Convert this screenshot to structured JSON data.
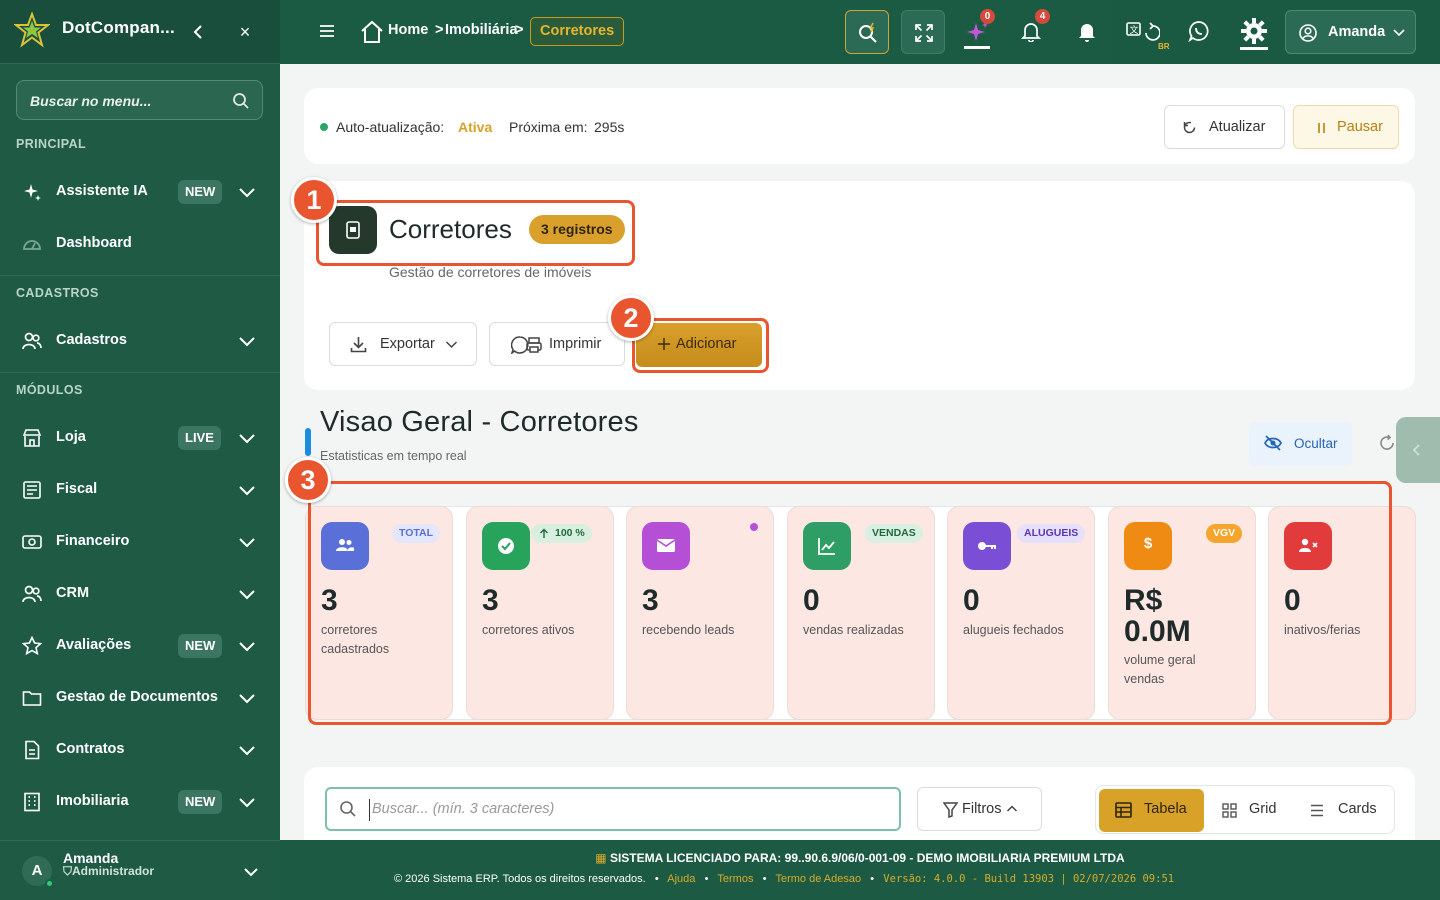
{
  "sidebar": {
    "brand": "DotCompan...",
    "search_placeholder": "Buscar no menu...",
    "sections": {
      "principal": "PRINCIPAL",
      "cadastros": "CADASTROS",
      "modulos": "MÓDULOS"
    },
    "items": [
      {
        "label": "Assistente IA",
        "badge": "NEW",
        "icon": "sparkle-icon"
      },
      {
        "label": "Dashboard",
        "icon": "gauge-icon"
      },
      {
        "label": "Cadastros",
        "icon": "users-icon"
      },
      {
        "label": "Loja",
        "badge": "LIVE",
        "icon": "store-icon"
      },
      {
        "label": "Fiscal",
        "icon": "receipt-icon"
      },
      {
        "label": "Financeiro",
        "icon": "cash-icon"
      },
      {
        "label": "CRM",
        "icon": "users-icon"
      },
      {
        "label": "Avaliações",
        "badge": "NEW",
        "icon": "star-icon"
      },
      {
        "label": "Gestao de Documentos",
        "icon": "folder-icon"
      },
      {
        "label": "Contratos",
        "icon": "document-icon"
      },
      {
        "label": "Imobiliaria",
        "badge": "NEW",
        "icon": "building-icon"
      }
    ],
    "user": {
      "initial": "A",
      "name": "Amanda",
      "role": "Administrador"
    }
  },
  "topbar": {
    "breadcrumb": {
      "home": "Home",
      "sep1": ">",
      "section": "Imobiliária",
      "sep2": ">",
      "current": "Corretores"
    },
    "sparkle_count": "0",
    "notification_count": "4",
    "lang_tag": "BR",
    "user_name": "Amanda"
  },
  "autorefresh": {
    "label": "Auto-atualização:",
    "status": "Ativa",
    "next_label": "Próxima em:",
    "next_value": "295s",
    "update_button": "Atualizar",
    "pause_button": "Pausar"
  },
  "header": {
    "title": "Corretores",
    "count_badge": "3 registros",
    "subtitle": "Gestão de corretores de imóveis",
    "export_button": "Exportar",
    "print_button": "Imprimir",
    "add_button": "Adicionar"
  },
  "overview": {
    "title": "Visao Geral - Corretores",
    "subtitle": "Estatisticas em tempo real",
    "hide_button": "Ocultar"
  },
  "stats": [
    {
      "value": "3",
      "label": "corretores cadastrados",
      "badge": "TOTAL",
      "color": "#5b6fd8"
    },
    {
      "value": "3",
      "label": "corretores ativos",
      "badge": "100 %",
      "color": "#27a35c"
    },
    {
      "value": "3",
      "label": "recebendo leads",
      "badge": "",
      "color": "#b54fd6"
    },
    {
      "value": "0",
      "label": "vendas realizadas",
      "badge": "VENDAS",
      "color": "#2e9e66"
    },
    {
      "value": "0",
      "label": "alugueis fechados",
      "badge": "ALUGUEIS",
      "color": "#7a4fd6"
    },
    {
      "value": "R$ 0.0M",
      "label": "volume geral vendas",
      "badge": "VGV",
      "color": "#ef8a12"
    },
    {
      "value": "0",
      "label": "inativos/ferias",
      "badge": "",
      "color": "#e23b3b"
    }
  ],
  "list": {
    "search_placeholder": "Buscar... (mín. 3 caracteres)",
    "filters_button": "Filtros",
    "views": [
      "Tabela",
      "Grid",
      "Cards"
    ],
    "active_view": "Tabela"
  },
  "footer": {
    "license_label": "SISTEMA LICENCIADO PARA:",
    "license_value": "99..90.6.9/06/0-001-09 - DEMO IMOBILIARIA PREMIUM LTDA",
    "copyright": "© 2026 Sistema ERP. Todos os direitos reservados.",
    "links": [
      "Ajuda",
      "Termos",
      "Termo de Adesao"
    ],
    "version": "Versão: 4.0.0 - Build 13903 | 02/07/2026 09:51"
  },
  "annotations": [
    "1",
    "2",
    "3"
  ],
  "colors": {
    "sidebar": "#1f5a45",
    "accent": "#d9a12b",
    "annotation": "#e8552f",
    "stat_bg": "#fde7e2"
  }
}
